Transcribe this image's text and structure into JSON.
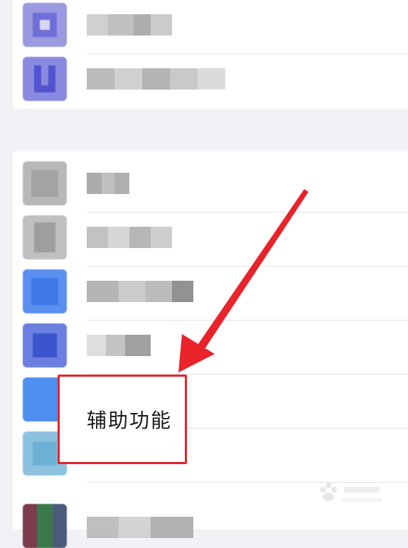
{
  "colors": {
    "background": "#f2f2f6",
    "card": "#ffffff",
    "callout_border": "#e8232a",
    "arrow": "#e8232a"
  },
  "settings_list": {
    "callout_label": "辅助功能",
    "rows": [
      {
        "icon": "purple-app-icon",
        "pixelated": true
      },
      {
        "icon": "purple-app-icon",
        "pixelated": true
      },
      {
        "icon": "gray-app-icon",
        "pixelated": true
      },
      {
        "icon": "gray-app-icon",
        "pixelated": true
      },
      {
        "icon": "blue-app-icon",
        "pixelated": true
      },
      {
        "icon": "blue-app-icon",
        "pixelated": true
      },
      {
        "icon": "accessibility-icon",
        "pixelated": true
      },
      {
        "icon": "teal-app-icon",
        "pixelated": true
      },
      {
        "icon": "multicolor-app-icon",
        "pixelated": true
      }
    ]
  },
  "watermark": {
    "icon": "baidu-jingyan-watermark-icon"
  }
}
